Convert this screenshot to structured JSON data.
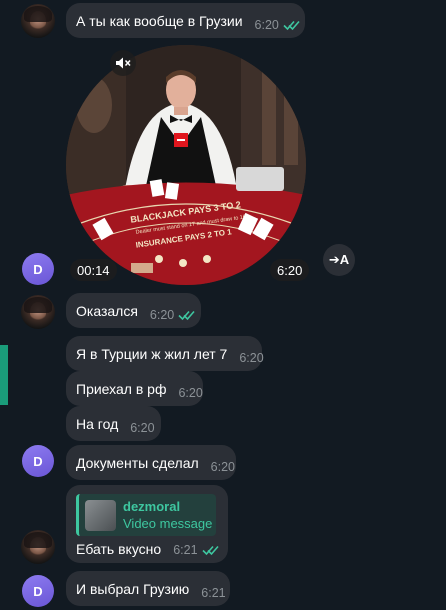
{
  "messages": [
    {
      "text": "А ты как вообще в Грузии",
      "time": "6:20"
    },
    {
      "text": "Оказался",
      "time": "6:20"
    },
    {
      "text": "Я в Турции ж жил лет 7",
      "time": "6:20"
    },
    {
      "text": "Приехал в рф",
      "time": "6:20"
    },
    {
      "text": "На год",
      "time": "6:20"
    },
    {
      "text": "Документы сделал",
      "time": "6:20"
    },
    {
      "text": "Ебать вкусно",
      "time": "6:21"
    },
    {
      "text": "И выбрал Грузию",
      "time": "6:21"
    }
  ],
  "video_message": {
    "duration": "00:14",
    "time": "6:20",
    "table_text_1": "BLACKJACK PAYS 3 TO 2",
    "table_text_2": "Dealer must stand on 17 and must draw to 16",
    "table_text_3": "INSURANCE PAYS 2 TO 1"
  },
  "share_button": {
    "label": "➔A"
  },
  "reply_quote": {
    "name": "dezmoral",
    "subtitle": "Video message"
  },
  "avatar_letter": "D",
  "icons": {
    "mute": "speaker-muted-icon",
    "read": "double-check-icon",
    "share": "share-arrow-icon"
  },
  "colors": {
    "background": "#121a22",
    "bubble": "#2b2f36",
    "accent": "#3ec7a0",
    "avatar_letter_bg": "#7b68ee"
  }
}
